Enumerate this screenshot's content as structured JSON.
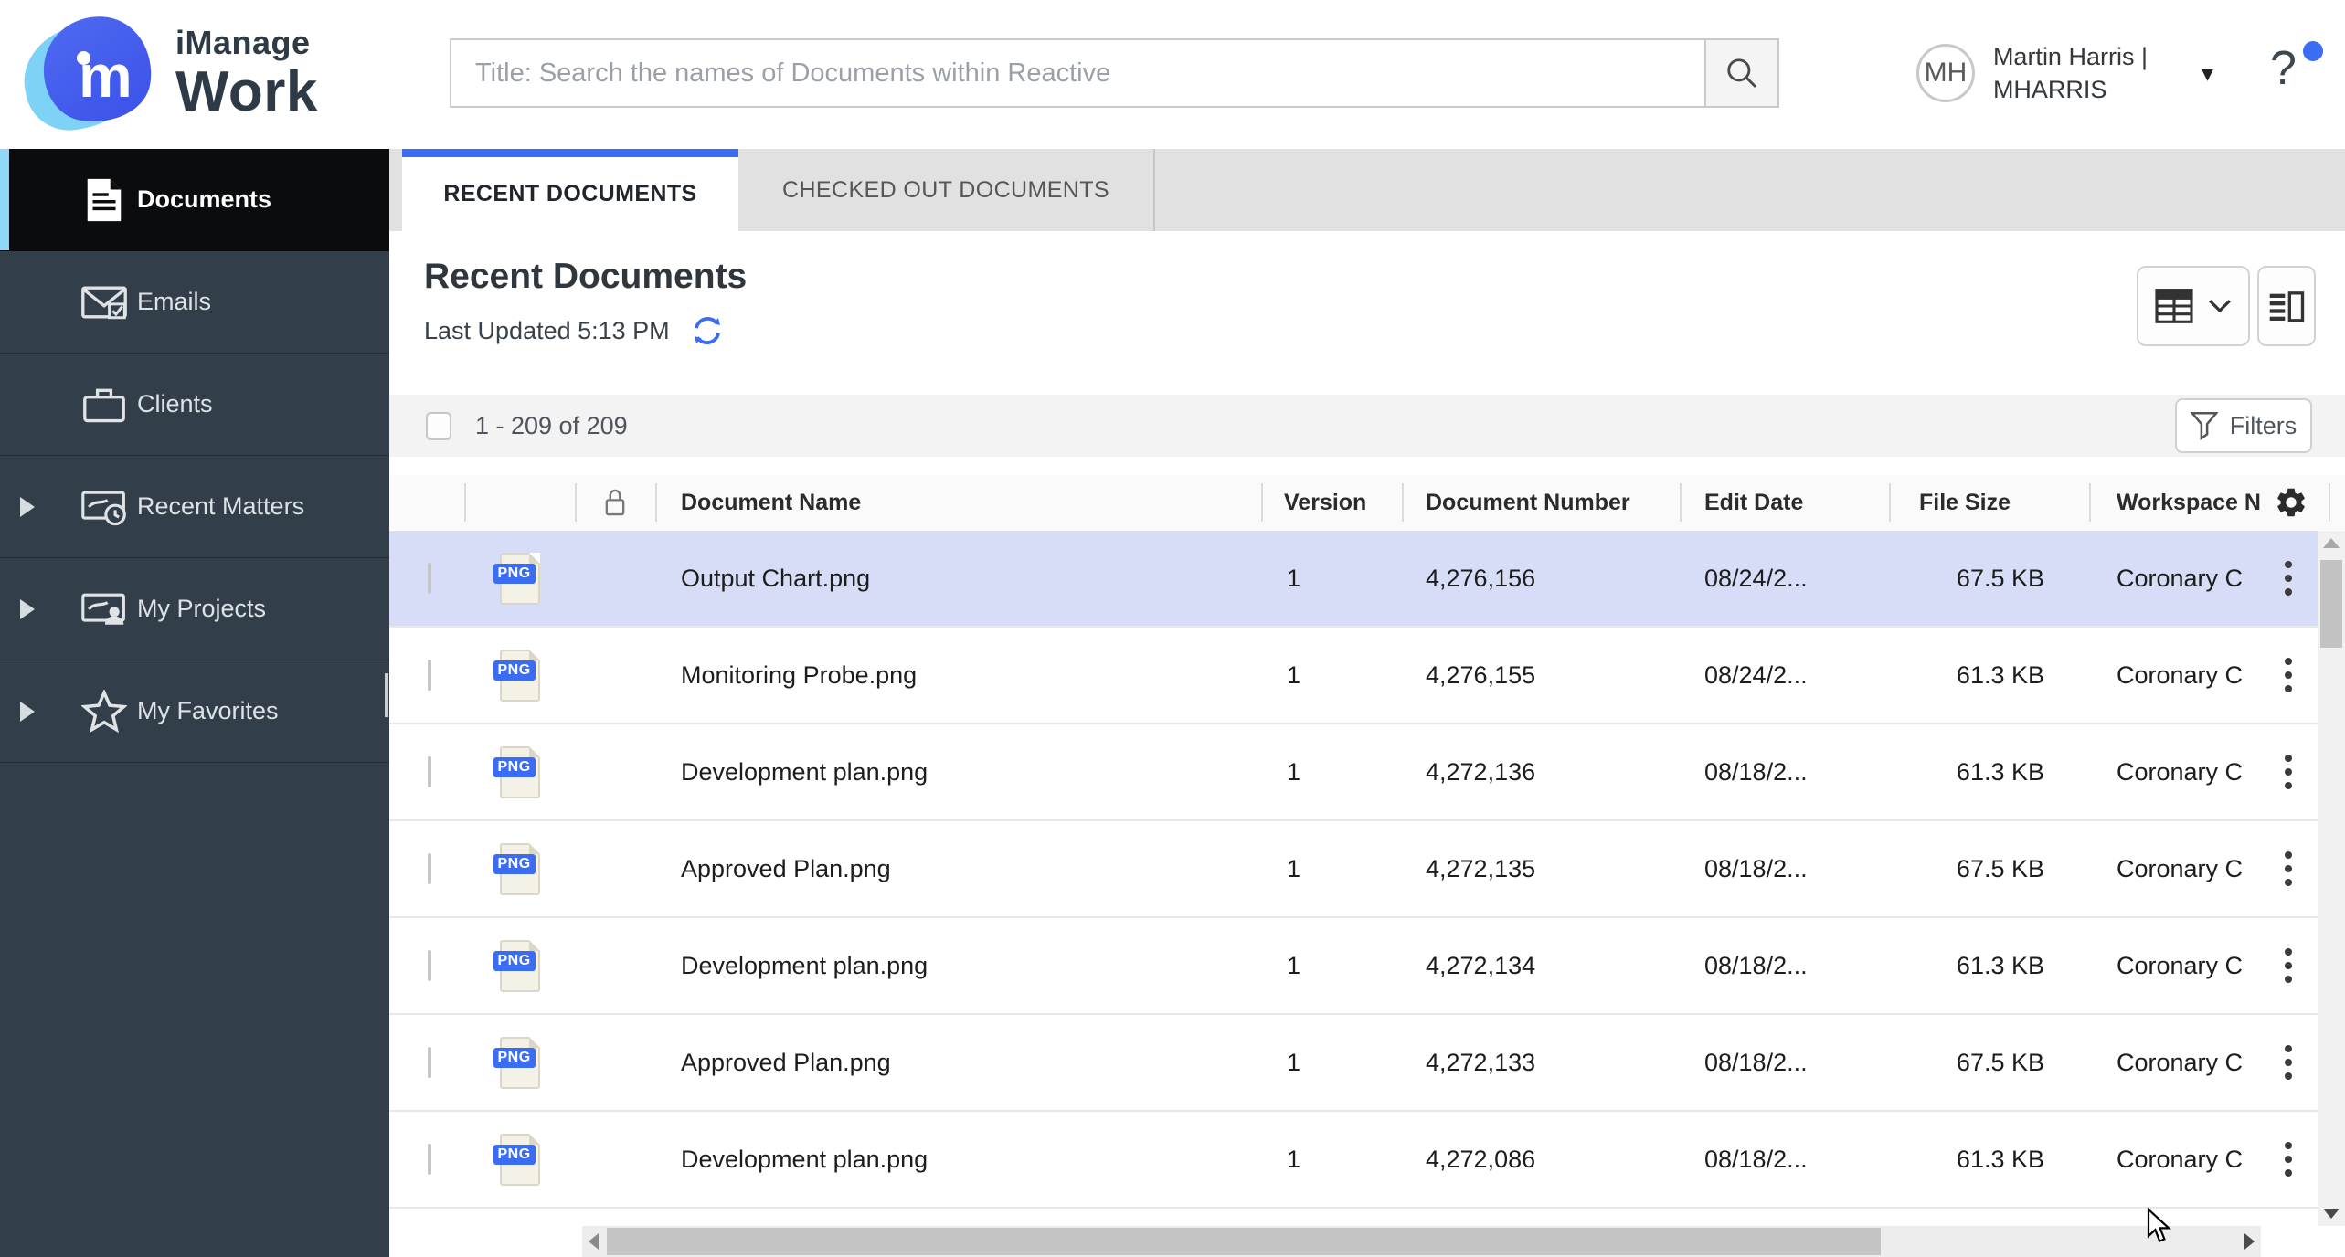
{
  "topbar": {
    "brand": {
      "line1": "iManage",
      "line2": "Work",
      "monogram": "m"
    },
    "search": {
      "placeholder": "Title: Search the names of Documents within Reactive",
      "value": ""
    },
    "user": {
      "initials": "MH",
      "name_line1": "Martin Harris |",
      "name_line2": "MHARRIS"
    },
    "icons": {
      "caret_down": "▾",
      "help": "?"
    }
  },
  "sidebar": {
    "items": [
      {
        "label": "Documents",
        "icon": "document-icon",
        "active": true,
        "expandable": false
      },
      {
        "label": "Emails",
        "icon": "email-icon",
        "active": false,
        "expandable": false
      },
      {
        "label": "Clients",
        "icon": "briefcase-icon",
        "active": false,
        "expandable": false
      },
      {
        "label": "Recent Matters",
        "icon": "recent-matters-icon",
        "active": false,
        "expandable": true
      },
      {
        "label": "My Projects",
        "icon": "my-projects-icon",
        "active": false,
        "expandable": true
      },
      {
        "label": "My Favorites",
        "icon": "star-icon",
        "active": false,
        "expandable": true
      }
    ]
  },
  "tabs": [
    {
      "label": "RECENT DOCUMENTS",
      "active": true
    },
    {
      "label": "CHECKED OUT DOCUMENTS",
      "active": false
    }
  ],
  "content": {
    "title": "Recent Documents",
    "last_updated": "Last Updated 5:13 PM",
    "range_label": "1 - 209 of 209",
    "filters_label": "Filters"
  },
  "table": {
    "headers": {
      "document_name": "Document Name",
      "version": "Version",
      "document_number": "Document Number",
      "edit_date": "Edit Date",
      "file_size": "File Size",
      "workspace": "Workspace N"
    },
    "rows": [
      {
        "file_type": "PNG",
        "name": "Output Chart.png",
        "version": "1",
        "number": "4,276,156",
        "edit_date": "08/24/2...",
        "file_size": "67.5 KB",
        "workspace": "Coronary C",
        "selected": true
      },
      {
        "file_type": "PNG",
        "name": "Monitoring Probe.png",
        "version": "1",
        "number": "4,276,155",
        "edit_date": "08/24/2...",
        "file_size": "61.3 KB",
        "workspace": "Coronary C",
        "selected": false
      },
      {
        "file_type": "PNG",
        "name": "Development plan.png",
        "version": "1",
        "number": "4,272,136",
        "edit_date": "08/18/2...",
        "file_size": "61.3 KB",
        "workspace": "Coronary C",
        "selected": false
      },
      {
        "file_type": "PNG",
        "name": "Approved Plan.png",
        "version": "1",
        "number": "4,272,135",
        "edit_date": "08/18/2...",
        "file_size": "67.5 KB",
        "workspace": "Coronary C",
        "selected": false
      },
      {
        "file_type": "PNG",
        "name": "Development plan.png",
        "version": "1",
        "number": "4,272,134",
        "edit_date": "08/18/2...",
        "file_size": "61.3 KB",
        "workspace": "Coronary C",
        "selected": false
      },
      {
        "file_type": "PNG",
        "name": "Approved Plan.png",
        "version": "1",
        "number": "4,272,133",
        "edit_date": "08/18/2...",
        "file_size": "67.5 KB",
        "workspace": "Coronary C",
        "selected": false
      },
      {
        "file_type": "PNG",
        "name": "Development plan.png",
        "version": "1",
        "number": "4,272,086",
        "edit_date": "08/18/2...",
        "file_size": "61.3 KB",
        "workspace": "Coronary C",
        "selected": false
      }
    ]
  },
  "colors": {
    "accent_blue": "#3a6cf4",
    "sidebar_bg": "#323e49",
    "active_item_bg": "#0b0c0e",
    "active_item_accent": "#8fd8f8",
    "selected_row_bg": "#d7ddf6",
    "tab_strip_bg": "#e1e1e1"
  }
}
